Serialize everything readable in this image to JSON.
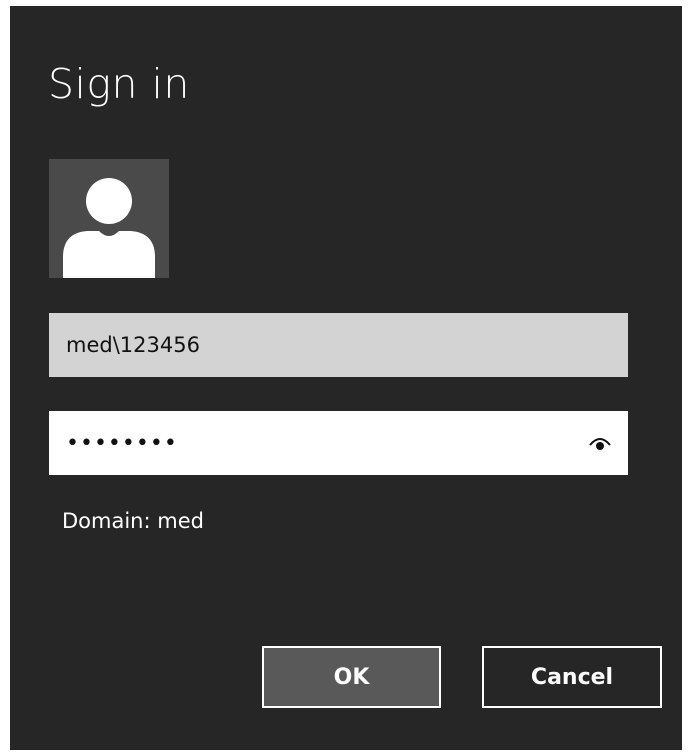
{
  "dialog": {
    "title": "Sign in",
    "avatar_icon": "user-silhouette-icon",
    "username": {
      "value": "med\\123456"
    },
    "password": {
      "masked_value": "••••••••",
      "reveal_icon": "eye-icon"
    },
    "domain_label": "Domain: med",
    "buttons": {
      "ok": "OK",
      "cancel": "Cancel"
    }
  },
  "colors": {
    "dialog_background": "#262626",
    "avatar_background": "#4a4a4a",
    "username_background": "#d3d3d3",
    "password_background": "#ffffff",
    "ok_button_background": "#595959",
    "text": "#ffffff"
  }
}
